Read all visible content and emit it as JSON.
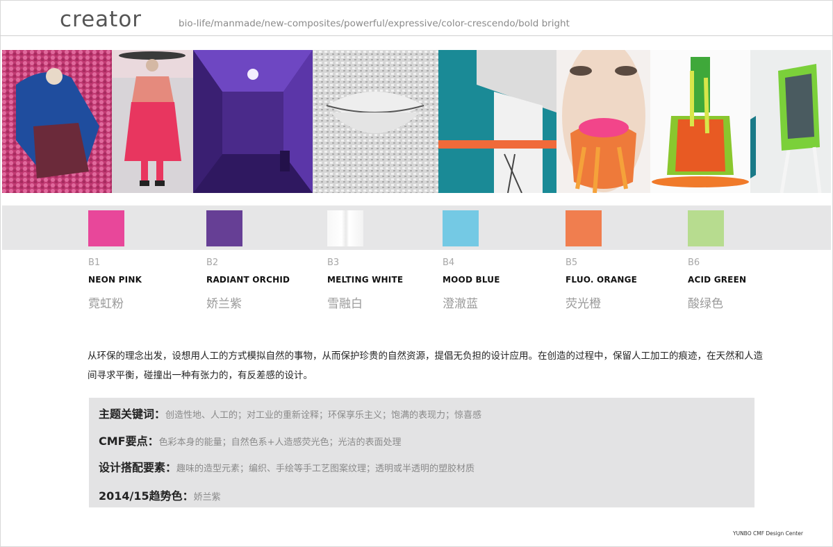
{
  "header": {
    "title": "creator",
    "subtitle": "bio-life/manmade/new-composites/powerful/expressive/color-crescendo/bold bright"
  },
  "colors": [
    {
      "code": "B1",
      "name": "NEON PINK",
      "name_cn": "霓虹粉",
      "hex": "#e8479a"
    },
    {
      "code": "B2",
      "name": "RADIANT ORCHID",
      "name_cn": "娇兰紫",
      "hex": "#663f95"
    },
    {
      "code": "B3",
      "name": "MELTING WHITE",
      "name_cn": "雪融白",
      "hex": "#f7f7f7"
    },
    {
      "code": "B4",
      "name": "MOOD BLUE",
      "name_cn": "澄澈蓝",
      "hex": "#74c9e4"
    },
    {
      "code": "B5",
      "name": "FLUO. ORANGE",
      "name_cn": "荧光橙",
      "hex": "#f07e4f"
    },
    {
      "code": "B6",
      "name": "ACID GREEN",
      "name_cn": "酸绿色",
      "hex": "#b7dc8f"
    }
  ],
  "description": "从环保的理念出发，设想用人工的方式模拟自然的事物，从而保护珍贵的自然资源，提倡无负担的设计应用。在创造的过程中，保留人工加工的痕迹，在天然和人造间寻求平衡，碰撞出一种有张力的，有反差感的设计。",
  "keywords": [
    {
      "label": "主题关键词：",
      "value": "创造性地、人工的；对工业的重新诠释；环保享乐主义；饱满的表现力；惊喜感"
    },
    {
      "label": "CMF要点：",
      "value": "色彩本身的能量；自然色系+人造感荧光色；光洁的表面处理"
    },
    {
      "label": "设计搭配要素：",
      "value": "趣味的造型元素；编织、手绘等手工艺图案纹理；透明或半透明的塑胶材质"
    },
    {
      "label": "2014/15趋势色：",
      "value": "娇兰紫"
    }
  ],
  "footer": "YUNBO CMF Design Center"
}
